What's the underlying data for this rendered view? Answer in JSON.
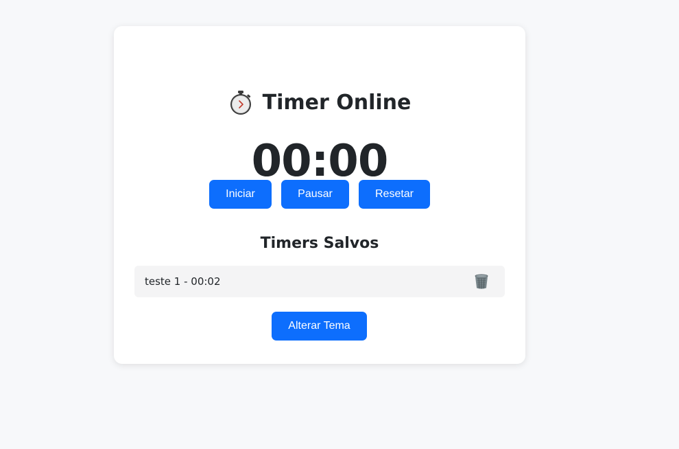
{
  "header": {
    "title": "Timer Online",
    "icon": "stopwatch-icon"
  },
  "timer": {
    "display": "00:00"
  },
  "controls": {
    "start_label": "Iniciar",
    "pause_label": "Pausar",
    "reset_label": "Resetar"
  },
  "saved": {
    "title": "Timers Salvos",
    "items": [
      {
        "label": "teste 1 - 00:02",
        "delete_icon": "trash-icon"
      }
    ]
  },
  "theme": {
    "toggle_label": "Alterar Tema"
  },
  "colors": {
    "accent": "#0d6efd",
    "background": "#f7f8fa",
    "card": "#ffffff",
    "text": "#212529",
    "item_background": "#f4f4f5"
  }
}
